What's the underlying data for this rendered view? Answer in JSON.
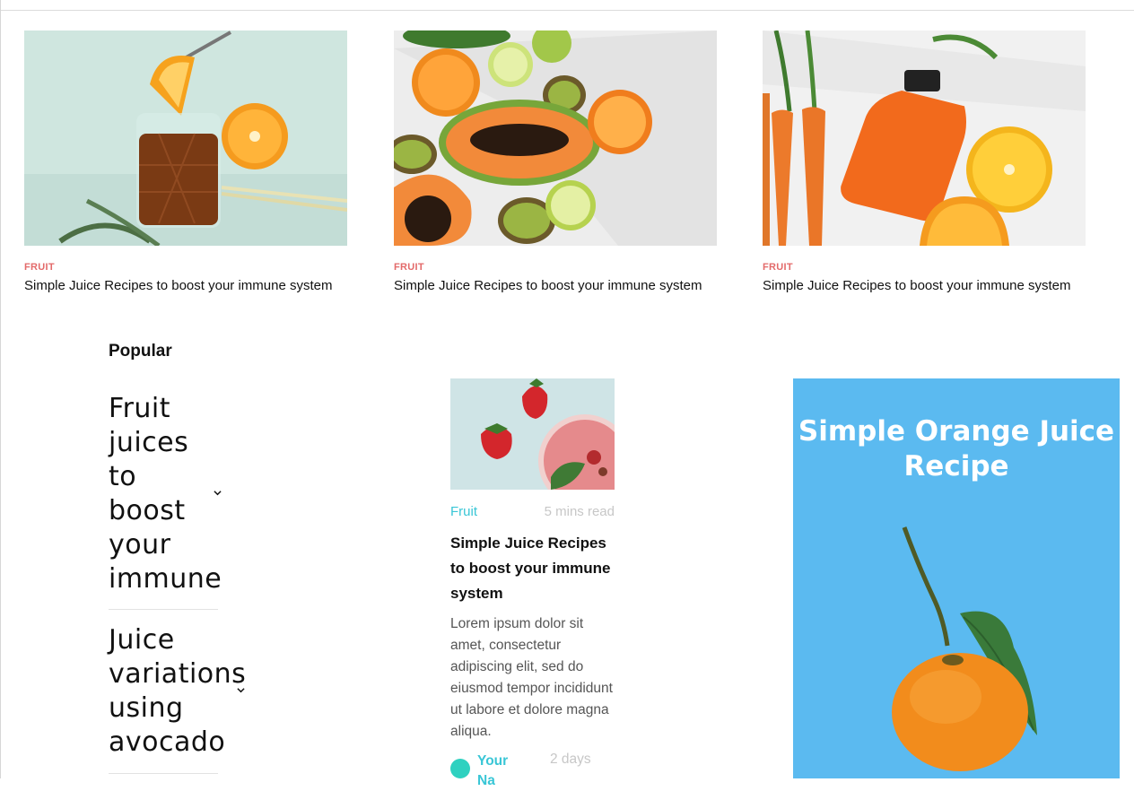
{
  "cards": [
    {
      "category": "FRUIT",
      "title": "Simple Juice Recipes to boost your immune system"
    },
    {
      "category": "FRUIT",
      "title": "Simple Juice Recipes to boost your immune system"
    },
    {
      "category": "FRUIT",
      "title": "Simple Juice Recipes to boost your immune system"
    }
  ],
  "popular": {
    "heading": "Popular",
    "items": [
      {
        "label": "Fruit juices to boost your immune"
      },
      {
        "label": "Juice variations using avocado"
      }
    ]
  },
  "post": {
    "category": "Fruit",
    "read_time": "5 mins read",
    "title": "Simple Juice Recipes to boost your immune system",
    "excerpt": "Lorem ipsum dolor sit amet, consectetur adipiscing elit, sed do eiusmod tempor incididunt ut labore et dolore magna aliqua.",
    "author": "Your Na",
    "date": "2 days"
  },
  "promo": {
    "title": "Simple Orange Juice Recipe"
  },
  "colors": {
    "category_red": "#e36a6a",
    "accent_cyan": "#39c6d6",
    "promo_blue": "#5bbaf0"
  }
}
